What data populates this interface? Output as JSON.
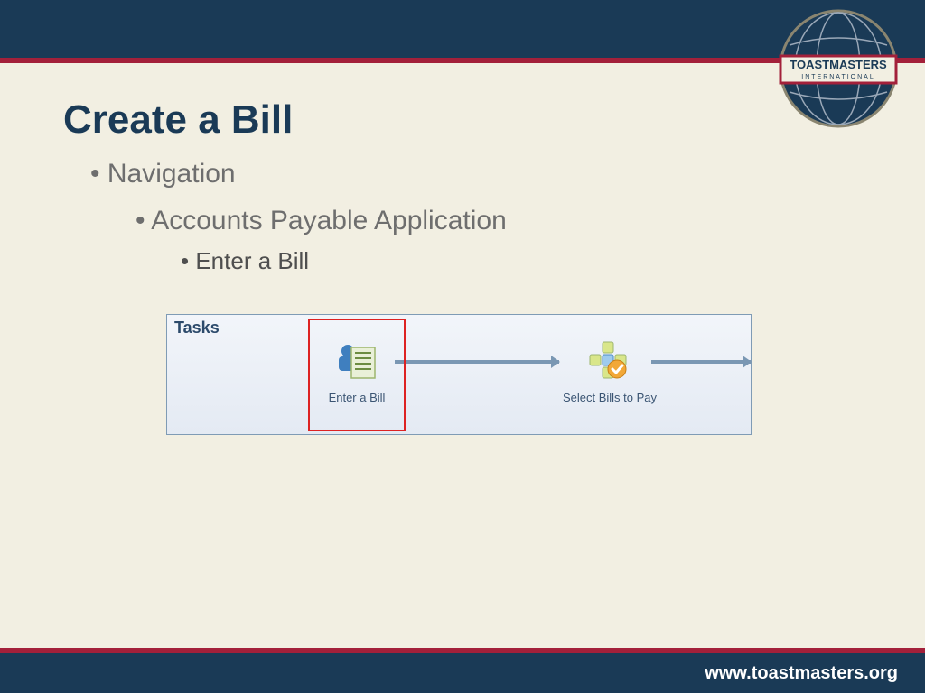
{
  "title": "Create a Bill",
  "bullets": {
    "level1": "Navigation",
    "level2": "Accounts Payable Application",
    "level3": "Enter a Bill"
  },
  "tasks": {
    "header": "Tasks",
    "item1": "Enter a Bill",
    "item2": "Select Bills to Pay"
  },
  "logo": {
    "line1": "TOASTMASTERS",
    "line2": "INTERNATIONAL"
  },
  "footer": "www.toastmasters.org"
}
